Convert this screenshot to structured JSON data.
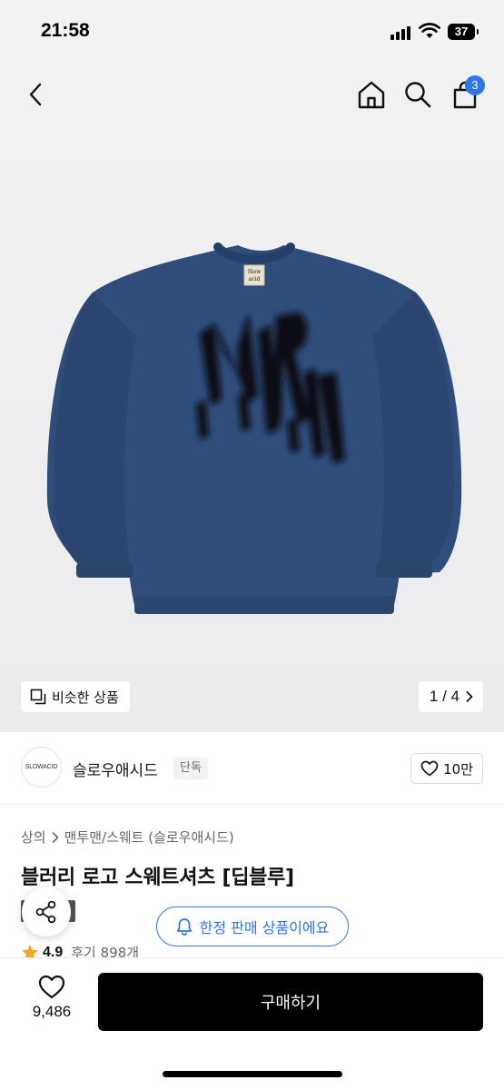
{
  "status_bar": {
    "time": "21:58",
    "battery": "37"
  },
  "header": {
    "cart_count": "3"
  },
  "gallery": {
    "similar_label": "비슷한 상품",
    "pager": "1 / 4"
  },
  "brand": {
    "logo_text": "SLOWACID",
    "name": "슬로우애시드",
    "exclusive": "단독",
    "likes": "10만"
  },
  "product": {
    "breadcrumb": [
      "상의",
      "맨투맨/스웨트 (슬로우애시드)"
    ],
    "title": "블러리 로고 스웨트셔츠 [딥블루]",
    "sale_badge": "세일",
    "rating": "4.9",
    "reviews": "후기 898개"
  },
  "limited_banner": "한정 판매 상품이에요",
  "bottom_bar": {
    "wish_count": "9,486",
    "buy_label": "구매하기"
  },
  "colors": {
    "accent": "#2f74e8",
    "sweatshirt": "#2e4d7a",
    "buy_button": "#000000"
  }
}
